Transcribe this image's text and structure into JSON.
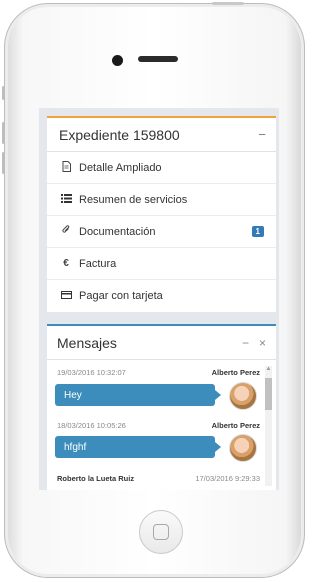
{
  "panel_expediente": {
    "title": "Expediente 159800",
    "collapse": "−",
    "items": [
      {
        "icon": "document-icon",
        "label": "Detalle Ampliado"
      },
      {
        "icon": "list-icon",
        "label": "Resumen de servicios"
      },
      {
        "icon": "paperclip-icon",
        "label": "Documentación",
        "badge": "1"
      },
      {
        "icon": "euro-icon",
        "label": "Factura"
      },
      {
        "icon": "credit-card-icon",
        "label": "Pagar con tarjeta"
      }
    ]
  },
  "panel_mensajes": {
    "title": "Mensajes",
    "minimize": "−",
    "close": "×",
    "messages": [
      {
        "date": "19/03/2016 10:32:07",
        "author": "Alberto Perez",
        "text": "Hey"
      },
      {
        "date": "18/03/2016 10:05:26",
        "author": "Alberto Perez",
        "text": "hfghf"
      },
      {
        "author": "Roberto la Lueta Ruiz",
        "date": "17/03/2016 9:29:33"
      }
    ]
  },
  "colors": {
    "accent_orange": "#f0a33a",
    "accent_blue": "#3c8dbc",
    "badge_blue": "#337ab7"
  }
}
